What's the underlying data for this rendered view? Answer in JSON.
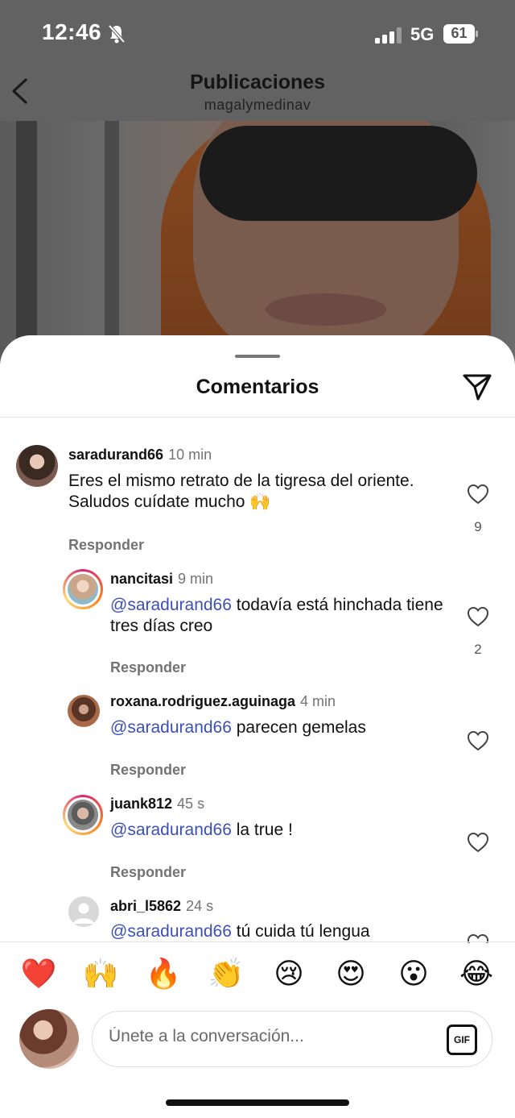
{
  "status_bar": {
    "time": "12:46",
    "network": "5G",
    "battery": "61"
  },
  "header": {
    "title": "Publicaciones",
    "subtitle": "magalymedinav"
  },
  "sheet": {
    "title": "Comentarios"
  },
  "comments": [
    {
      "username": "saradurand66",
      "age": "10 min",
      "mention": "",
      "text": "Eres el mismo retrato de la tigresa del oriente. Saludos cuídate mucho 🙌",
      "reply_label": "Responder",
      "likes": "9"
    },
    {
      "username": "nancitasi",
      "age": "9 min",
      "mention": "@saradurand66",
      "text": " todavía está hinchada tiene tres días creo",
      "reply_label": "Responder",
      "likes": "2"
    },
    {
      "username": "roxana.rodriguez.aguinaga",
      "age": "4 min",
      "mention": "@saradurand66",
      "text": " parecen gemelas",
      "reply_label": "Responder",
      "likes": ""
    },
    {
      "username": "juank812",
      "age": "45 s",
      "mention": "@saradurand66",
      "text": " la true !",
      "reply_label": "Responder",
      "likes": ""
    },
    {
      "username": "abri_l5862",
      "age": "24 s",
      "mention": "@saradurand66",
      "text": " tú cuida tú lengua",
      "reply_label": "",
      "likes": ""
    }
  ],
  "emojis": [
    "❤️",
    "🙌",
    "🔥",
    "👏",
    "😢",
    "😍",
    "😮",
    "😂"
  ],
  "composer": {
    "placeholder": "Únete a la conversación...",
    "gif_label": "GIF"
  }
}
